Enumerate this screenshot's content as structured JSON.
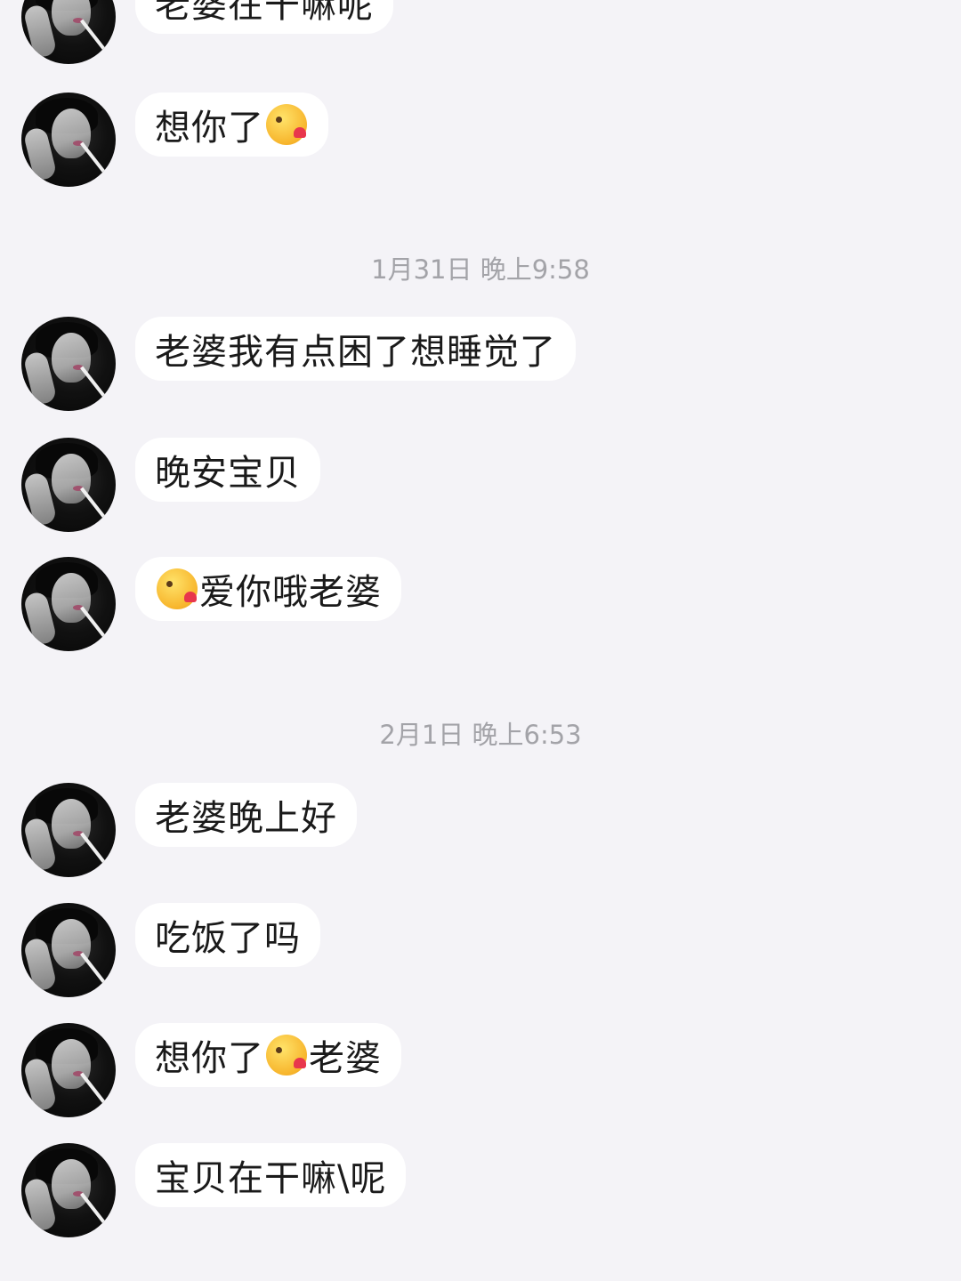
{
  "messages_top": [
    {
      "text": "老婆在干嘛呢"
    },
    {
      "text_before": "想你了",
      "emoji": "kissing-heart-emoji",
      "text_after": ""
    }
  ],
  "timestamps": [
    "1月31日 晚上9:58",
    "2月1日 晚上6:53"
  ],
  "group_1": [
    {
      "text": "老婆我有点困了想睡觉了"
    },
    {
      "text": "晚安宝贝"
    },
    {
      "text_before": "",
      "emoji": "kissing-heart-emoji",
      "text_after": "爱你哦老婆"
    }
  ],
  "group_2": [
    {
      "text": "老婆晚上好"
    },
    {
      "text": "吃饭了吗"
    },
    {
      "text_before": "想你了",
      "emoji": "kissing-heart-emoji",
      "text_after": "老婆"
    },
    {
      "text": "宝贝在干嘛\\呢"
    }
  ],
  "colors": {
    "background": "#f4f3f7",
    "bubble": "#ffffff",
    "timestamp_text": "#a3a3a8",
    "message_text": "#1a1a1a"
  }
}
